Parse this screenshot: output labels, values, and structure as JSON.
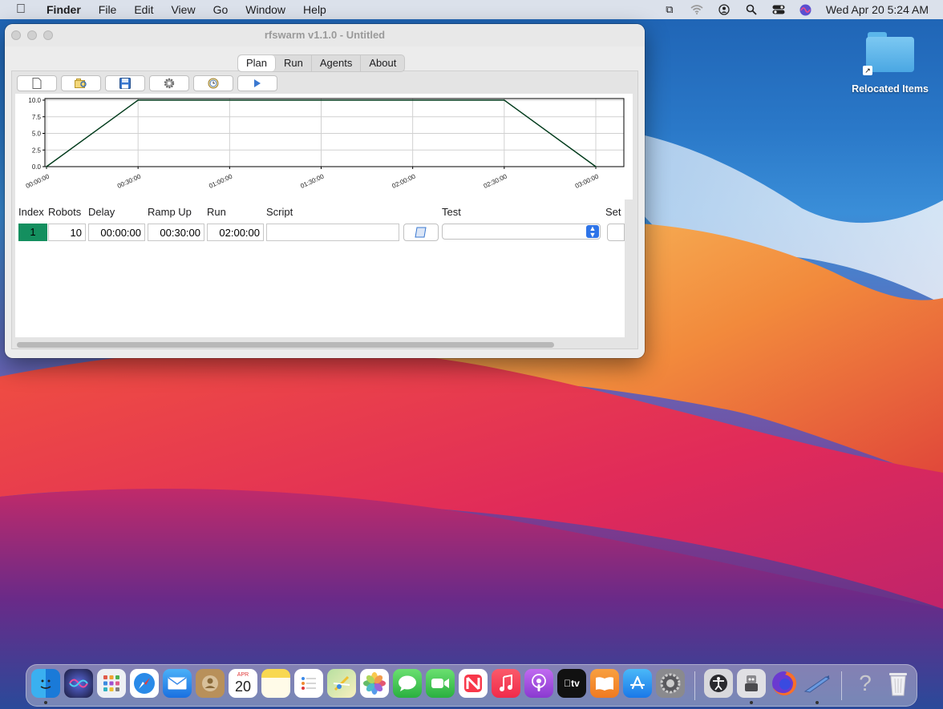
{
  "menubar": {
    "apple": "",
    "items": [
      "Finder",
      "File",
      "Edit",
      "View",
      "Go",
      "Window",
      "Help"
    ],
    "clock": "Wed Apr 20  5:24 AM"
  },
  "desktop": {
    "folder_label": "Relocated Items"
  },
  "window": {
    "title": "rfswarm v1.1.0 - Untitled",
    "tabs": [
      "Plan",
      "Run",
      "Agents",
      "About"
    ],
    "active_tab": "Plan"
  },
  "toolbar": {
    "buttons": [
      "new-icon",
      "open-icon",
      "save-icon",
      "settings-icon",
      "schedule-icon",
      "play-icon"
    ]
  },
  "chart_data": {
    "type": "line",
    "title": "",
    "xlabel": "",
    "ylabel": "",
    "x_ticks": [
      "00:00:00",
      "00:30:00",
      "01:00:00",
      "01:30:00",
      "02:00:00",
      "02:30:00",
      "03:00:00"
    ],
    "y_ticks": [
      "0.0",
      "2.5",
      "5.0",
      "7.5",
      "10.0"
    ],
    "ylim": [
      0,
      10
    ],
    "xlim": [
      "00:00:00",
      "03:00:00"
    ],
    "grid": true,
    "series": [
      {
        "x": [
          "00:00:00",
          "00:30:00",
          "02:30:00",
          "03:00:00"
        ],
        "y": [
          0,
          10,
          10,
          0
        ]
      }
    ]
  },
  "grid": {
    "headers": [
      "Index",
      "Robots",
      "Delay",
      "Ramp Up",
      "Run",
      "Script",
      "Test",
      "Set"
    ],
    "row": {
      "index": "1",
      "robots": "10",
      "delay": "00:00:00",
      "ramp_up": "00:30:00",
      "run": "02:00:00",
      "script": "",
      "test": ""
    }
  },
  "dock": {
    "apps": [
      "Finder",
      "Siri",
      "Launchpad",
      "Safari",
      "Mail",
      "Contacts",
      "Calendar",
      "Notes",
      "Reminders",
      "Maps",
      "Photos",
      "Messages",
      "FaceTime",
      "News",
      "Music",
      "Podcasts",
      "TV",
      "Books",
      "App Store",
      "System Preferences",
      "Accessibility Inspector",
      "Automator",
      "Firefox",
      "Python Launcher",
      "Help",
      "Trash"
    ],
    "calendar_month": "APR",
    "calendar_day": "20"
  },
  "colors": {
    "index_cell": "#148f5f",
    "plot_line": "#003a1a"
  }
}
